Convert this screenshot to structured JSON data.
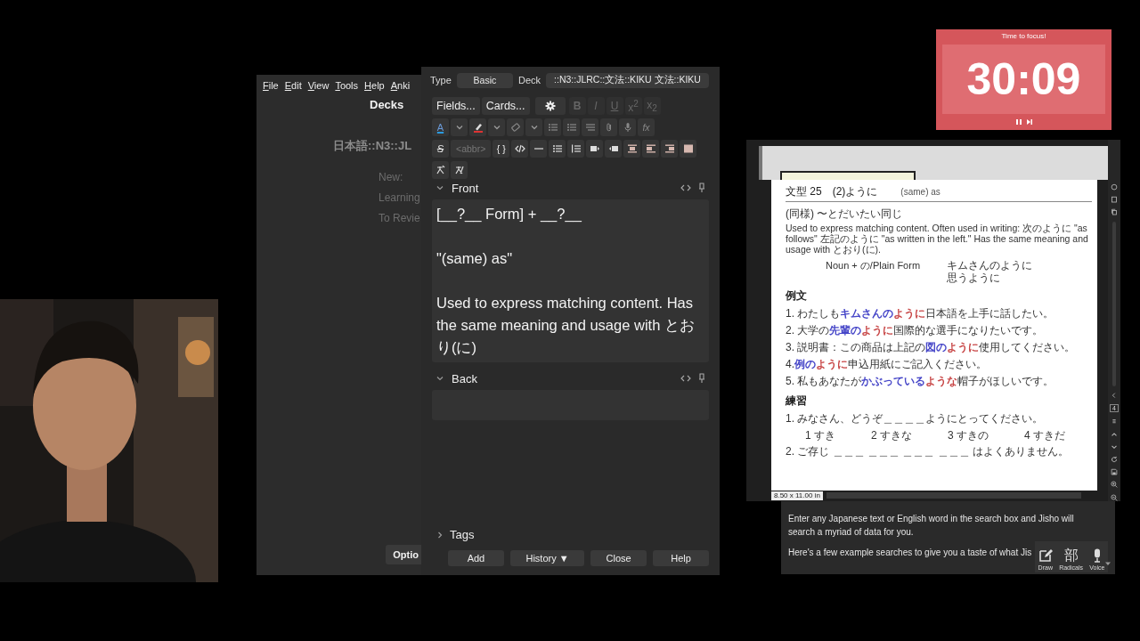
{
  "deck_window": {
    "menu": [
      "File",
      "Edit",
      "View",
      "Tools",
      "Help",
      "Anki"
    ],
    "title": "Decks",
    "deck_name": "日本語::N3::JL",
    "stats": [
      "New:",
      "Learning",
      "To Revie"
    ],
    "options_button": "Optio"
  },
  "editor": {
    "type_label": "Type",
    "type_value": "Basic",
    "deck_label": "Deck",
    "deck_value": "::N3::JLRC::文法::KIKU 文法::KIKU",
    "toolbar": {
      "fields": "Fields...",
      "cards": "Cards...",
      "bold": "B",
      "italic": "I",
      "underline": "U",
      "superscript": "x$^{2}$",
      "subscript": "x$_{2}$",
      "format_disabled": true,
      "text_color": "A",
      "formula": "fx",
      "strike": "S",
      "abbr": "<abbr>",
      "braces": "{ }"
    },
    "fields": [
      {
        "name": "Front",
        "expanded": true,
        "paragraphs": [
          "[__?__ Form] + __?__",
          "\"(same) as\"",
          "Used to express matching content. Has the same meaning and usage with とおり(に)"
        ]
      },
      {
        "name": "Back",
        "expanded": true
      }
    ],
    "tags": {
      "label": "Tags",
      "expanded": false
    },
    "buttons": [
      "Add",
      "History ▼",
      "Close",
      "Help"
    ]
  },
  "timer": {
    "title": "Time to focus!",
    "time": "30:09"
  },
  "pdf": {
    "heading": "文型 25　(2)ように",
    "heading_gloss": "(same) as",
    "subheading": "(同様) 〜とだいたい同じ",
    "description": "Used to express matching content. Often used in writing: 次のように \"as follows\" 左記のように \"as written in the left.\" Has the same meaning and usage with とおり(に).",
    "pattern_form": "Noun + の/Plain Form",
    "pattern_examples": [
      "キムさんのように",
      "思うように"
    ],
    "examples_heading": "例文",
    "examples": [
      {
        "segments": [
          {
            "text": "1. わたしも"
          },
          {
            "text": "キムさんの",
            "color": "#4646c8"
          },
          {
            "text": "ように",
            "color": "#c84646"
          },
          {
            "text": "日本語を上手に話したい。"
          }
        ]
      },
      {
        "segments": [
          {
            "text": "2. 大学の"
          },
          {
            "text": "先輩の",
            "color": "#4646c8"
          },
          {
            "text": "ように",
            "color": "#c84646"
          },
          {
            "text": "国際的な選手になりたいです。"
          }
        ]
      },
      {
        "segments": [
          {
            "text": "3. 説明書：この商品は上記の"
          },
          {
            "text": "図の",
            "color": "#4646c8"
          },
          {
            "text": "ように",
            "color": "#c84646"
          },
          {
            "text": "使用してください。"
          }
        ]
      },
      {
        "segments": [
          {
            "text": "4."
          },
          {
            "text": "例の",
            "color": "#4646c8"
          },
          {
            "text": "ように",
            "color": "#c84646"
          },
          {
            "text": "申込用紙にご記入ください。"
          }
        ]
      },
      {
        "segments": [
          {
            "text": "5. 私もあなたが"
          },
          {
            "text": "かぶっている",
            "color": "#4646c8"
          },
          {
            "text": "ような",
            "color": "#c84646"
          },
          {
            "text": "帽子がほしいです。"
          }
        ]
      }
    ],
    "exercise_heading": "練習",
    "exercises": [
      {
        "question": "1. みなさん、どうぞ＿＿＿＿ようにとってください。",
        "choices": [
          "1 すき",
          "2 すきな",
          "3 すきの",
          "4 すきだ"
        ]
      },
      {
        "question": "2. ご存じ ＿＿＿ ＿＿＿ ＿＿＿ ＿＿＿ はよくありません。"
      }
    ],
    "page_size": "8.50 x 11.00 in",
    "page_number": "4"
  },
  "jisho": {
    "paragraphs": [
      "Enter any Japanese text or English word in the search box and Jisho will search a myriad of data for you.",
      "Here's a few example searches to give you a taste of what Jis"
    ],
    "tools": [
      {
        "kind": "pen",
        "label": "Draw"
      },
      {
        "kind": "glyph",
        "glyph": "部",
        "label": "Radicals"
      },
      {
        "kind": "mic",
        "label": "Voice"
      }
    ]
  }
}
